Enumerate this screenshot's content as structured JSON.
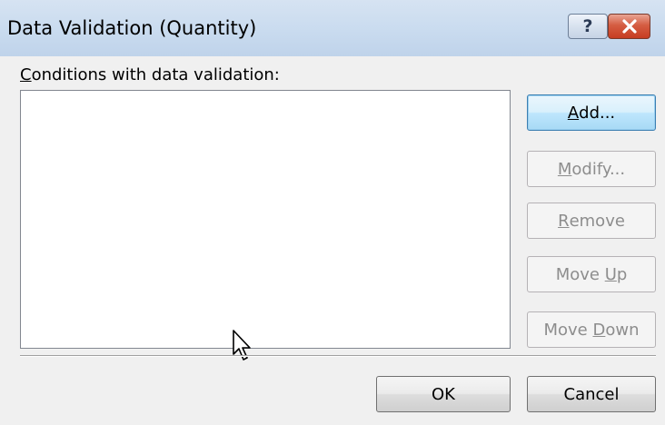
{
  "dialog": {
    "title": "Data Validation (Quantity)",
    "help_glyph": "?",
    "close_glyph": "✕",
    "help_icon": "help-question-icon",
    "close_icon": "close-icon"
  },
  "conditions": {
    "label_hotkey": "C",
    "label_rest": "onditions with data validation:",
    "items": []
  },
  "buttons": {
    "add": {
      "pre": "",
      "hotkey": "A",
      "post": "dd...",
      "enabled": true,
      "default": true
    },
    "modify": {
      "pre": "",
      "hotkey": "M",
      "post": "odify...",
      "enabled": false
    },
    "remove": {
      "pre": "",
      "hotkey": "R",
      "post": "emove",
      "enabled": false
    },
    "move_up": {
      "pre": "Move ",
      "hotkey": "U",
      "post": "p",
      "enabled": false
    },
    "move_down": {
      "pre": "Move ",
      "hotkey": "D",
      "post": "own",
      "enabled": false
    }
  },
  "footer": {
    "ok_label": "OK",
    "cancel_label": "Cancel"
  },
  "colors": {
    "titlebar": "#c9dbef",
    "close_button": "#c63d22",
    "default_button_border": "#3c7fb1",
    "disabled_text": "#8d8d8d"
  },
  "pointer_icon": "mouse-pointer-icon"
}
